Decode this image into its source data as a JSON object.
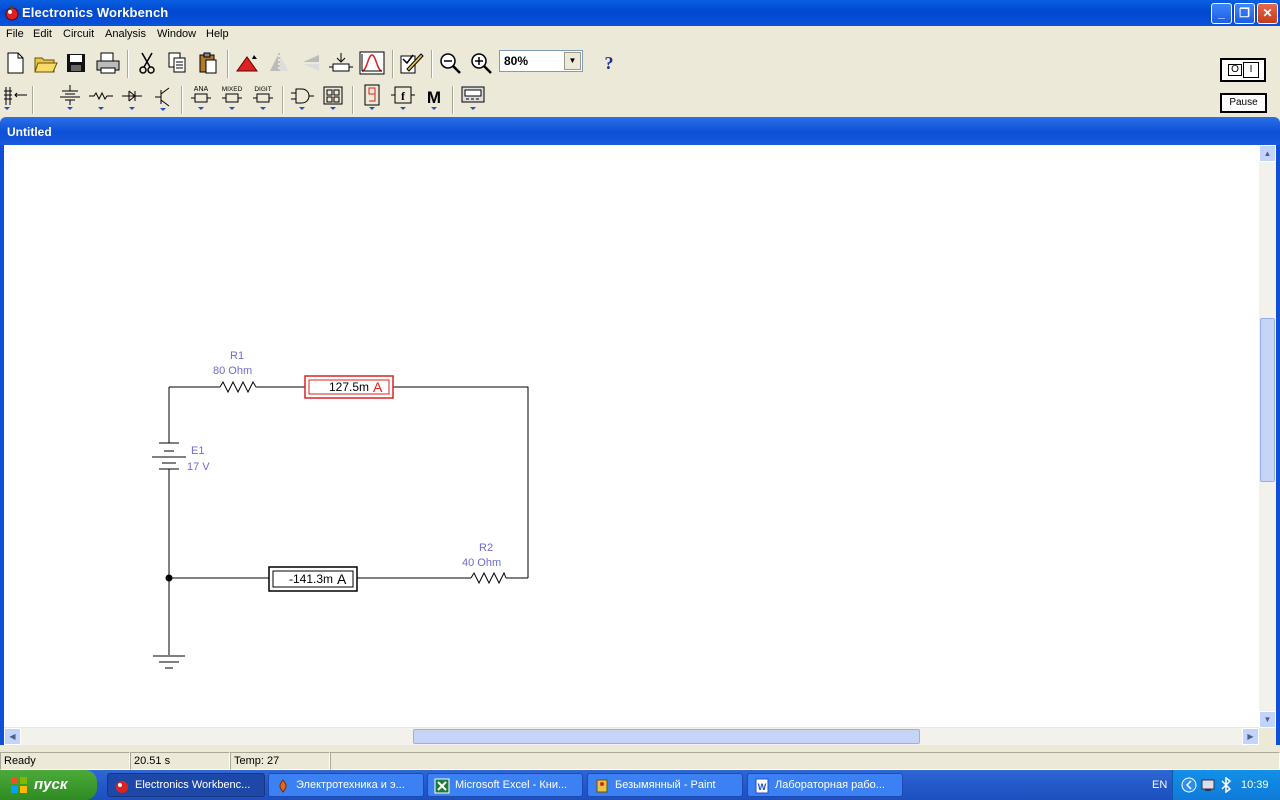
{
  "window": {
    "title": "Electronics Workbench",
    "minimize": "_",
    "restore": "❐",
    "close": "✕"
  },
  "menu": [
    "File",
    "Edit",
    "Circuit",
    "Analysis",
    "Window",
    "Help"
  ],
  "toolbar": {
    "zoom_value": "80%",
    "help_label": "?",
    "power_off": "O",
    "power_on": "I",
    "pause_label": "Pause",
    "parts": {
      "ana": "ANA",
      "mixed": "MIXED",
      "digit": "DIGIT",
      "misc": "M"
    }
  },
  "document": {
    "title": "Untitled"
  },
  "circuit": {
    "r1": {
      "name": "R1",
      "value": "80  Ohm"
    },
    "r2": {
      "name": "R2",
      "value": "40  Ohm"
    },
    "e1": {
      "name": "E1",
      "value": "17 V"
    },
    "ammeter1": {
      "reading": "127.5m",
      "unit": "A",
      "selected": true
    },
    "ammeter2": {
      "reading": "-141.3m",
      "unit": "A"
    }
  },
  "status": {
    "state": "Ready",
    "time": "20.51 s",
    "temp": "Temp:  27"
  },
  "taskbar": {
    "start": "пуск",
    "tasks": [
      {
        "label": "Electronics Workbenc...",
        "icon": "workbench-icon",
        "active": true
      },
      {
        "label": "Электротехника и э...",
        "icon": "reader-icon",
        "active": false
      },
      {
        "label": "Microsoft Excel - Кни...",
        "icon": "excel-icon",
        "active": false
      },
      {
        "label": "Безымянный - Paint",
        "icon": "paint-icon",
        "active": false
      },
      {
        "label": "Лабораторная рабо...",
        "icon": "word-icon",
        "active": false
      }
    ],
    "lang": "EN",
    "clock": "10:39"
  }
}
